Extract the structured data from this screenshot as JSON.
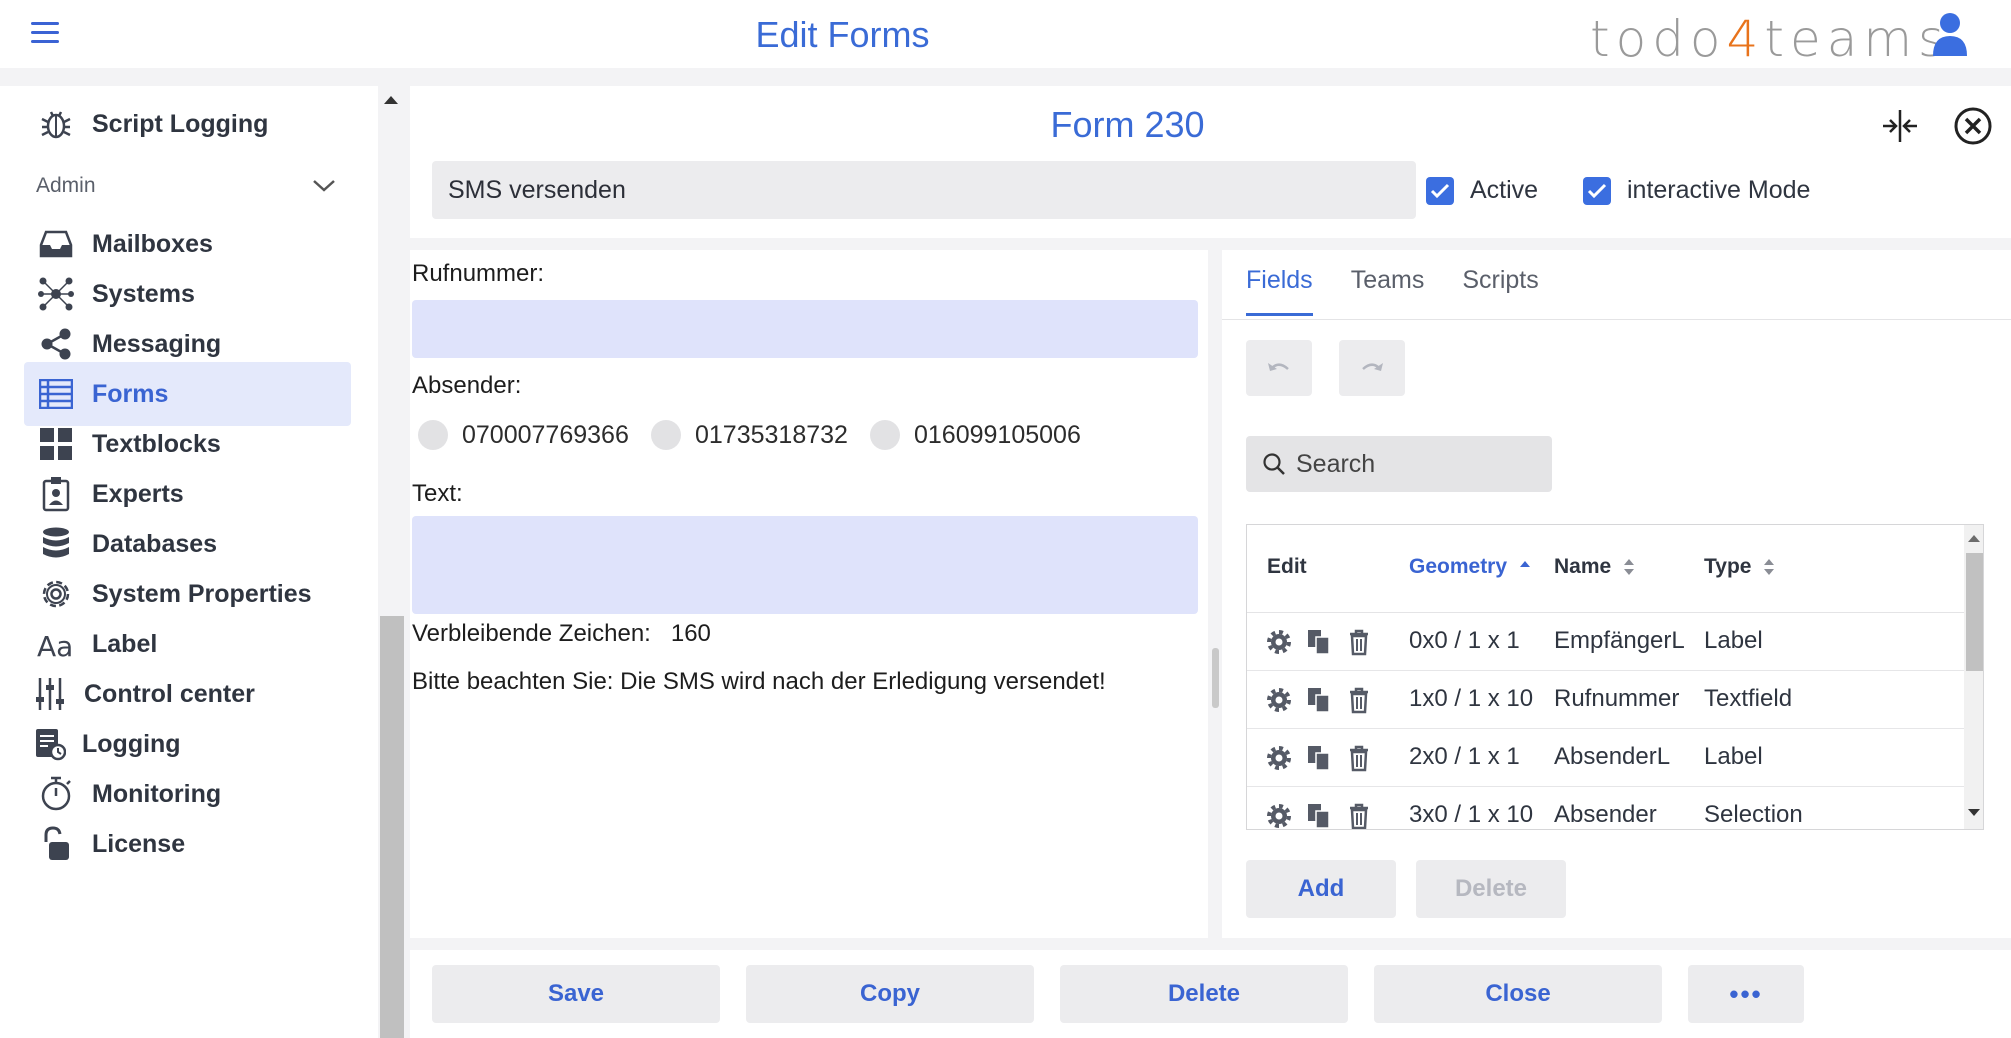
{
  "header": {
    "title": "Edit Forms",
    "brand_prefix": "todo",
    "brand_four": "4",
    "brand_suffix": "teams"
  },
  "sidebar": {
    "script_logging": "Script Logging",
    "admin_section": "Admin",
    "items": [
      {
        "label": "Mailboxes",
        "icon": "inbox-icon"
      },
      {
        "label": "Systems",
        "icon": "network-icon"
      },
      {
        "label": "Messaging",
        "icon": "share-icon"
      },
      {
        "label": "Forms",
        "icon": "list-icon",
        "active": true
      },
      {
        "label": "Textblocks",
        "icon": "grid-icon"
      },
      {
        "label": "Experts",
        "icon": "badge-icon"
      },
      {
        "label": "Databases",
        "icon": "database-icon"
      },
      {
        "label": "System Properties",
        "icon": "gear-icon"
      },
      {
        "label": "Label",
        "icon": "font-icon"
      },
      {
        "label": "Control center",
        "icon": "sliders-icon"
      },
      {
        "label": "Logging",
        "icon": "log-icon"
      },
      {
        "label": "Monitoring",
        "icon": "stopwatch-icon"
      },
      {
        "label": "License",
        "icon": "unlock-icon"
      }
    ]
  },
  "form": {
    "title": "Form 230",
    "name_value": "SMS versenden",
    "active_label": "Active",
    "interactive_label": "interactive Mode",
    "active_checked": true,
    "interactive_checked": true
  },
  "preview": {
    "rufnummer_label": "Rufnummer:",
    "absender_label": "Absender:",
    "radio_options": [
      "070007769366",
      "01735318732",
      "016099105006"
    ],
    "text_label": "Text:",
    "remaining_label": "Verbleibende Zeichen:",
    "remaining_value": "160",
    "notice": "Bitte beachten Sie: Die SMS wird nach der Erledigung versendet!"
  },
  "panel": {
    "tabs": [
      "Fields",
      "Teams",
      "Scripts"
    ],
    "active_tab": "Fields",
    "search_placeholder": "Search",
    "columns": [
      "Edit",
      "Geometry",
      "Name",
      "Type"
    ],
    "rows": [
      {
        "geometry": "0x0 / 1 x 1",
        "name": "EmpfängerL",
        "type": "Label"
      },
      {
        "geometry": "1x0 / 1 x 10",
        "name": "Rufnummer",
        "type": "Textfield"
      },
      {
        "geometry": "2x0 / 1 x 1",
        "name": "AbsenderL",
        "type": "Label"
      },
      {
        "geometry": "3x0 / 1 x 10",
        "name": "Absender",
        "type": "Selection"
      }
    ],
    "add_label": "Add",
    "delete_label": "Delete"
  },
  "footer": {
    "save": "Save",
    "copy": "Copy",
    "delete": "Delete",
    "close": "Close",
    "more": "•••"
  },
  "colors": {
    "accent": "#3a6bd6",
    "brand_orange": "#e8731b",
    "active_bg": "#e4e9fb",
    "field_bg": "#dfe3fb"
  }
}
